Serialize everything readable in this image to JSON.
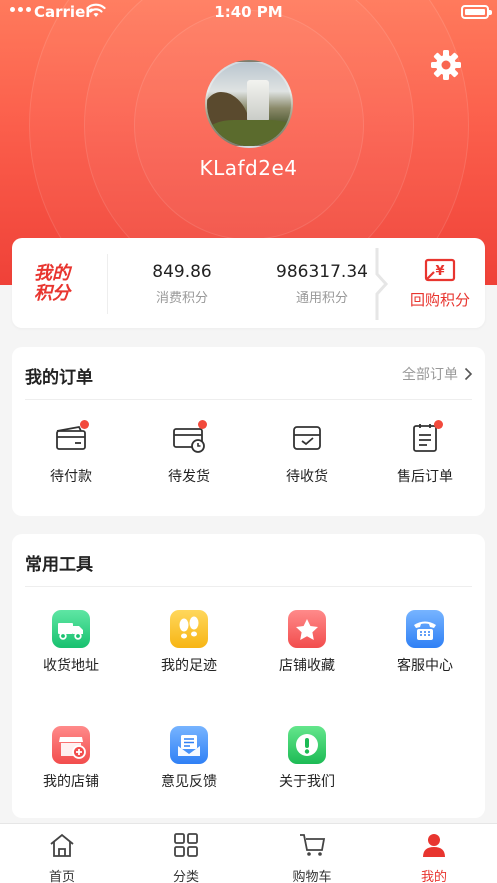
{
  "status_bar": {
    "carrier": "Carrier",
    "time": "1:40 PM"
  },
  "profile": {
    "username": "KLafd2e4"
  },
  "points": {
    "title_line1": "我的",
    "title_line2": "积分",
    "consumption_value": "849.86",
    "consumption_label": "消费积分",
    "general_value": "986317.34",
    "general_label": "通用积分",
    "buyback_label": "回购积分"
  },
  "orders": {
    "title": "我的订单",
    "all_label": "全部订单",
    "items": [
      {
        "label": "待付款",
        "badge": true
      },
      {
        "label": "待发货",
        "badge": true
      },
      {
        "label": "待收货",
        "badge": false
      },
      {
        "label": "售后订单",
        "badge": true
      }
    ]
  },
  "tools": {
    "title": "常用工具",
    "items": [
      {
        "label": "收货地址",
        "icon": "truck-icon"
      },
      {
        "label": "我的足迹",
        "icon": "footprint-icon"
      },
      {
        "label": "店铺收藏",
        "icon": "star-icon"
      },
      {
        "label": "客服中心",
        "icon": "phone-icon"
      },
      {
        "label": "我的店铺",
        "icon": "shop-icon"
      },
      {
        "label": "意见反馈",
        "icon": "feedback-icon"
      },
      {
        "label": "关于我们",
        "icon": "info-icon"
      }
    ]
  },
  "tabbar": {
    "items": [
      {
        "label": "首页",
        "icon": "home-icon"
      },
      {
        "label": "分类",
        "icon": "grid-icon"
      },
      {
        "label": "购物车",
        "icon": "cart-icon"
      },
      {
        "label": "我的",
        "icon": "person-icon",
        "active": true
      }
    ]
  },
  "colors": {
    "accent": "#e8352f",
    "header_top": "#ff7a5c",
    "header_bottom": "#ef4138"
  }
}
